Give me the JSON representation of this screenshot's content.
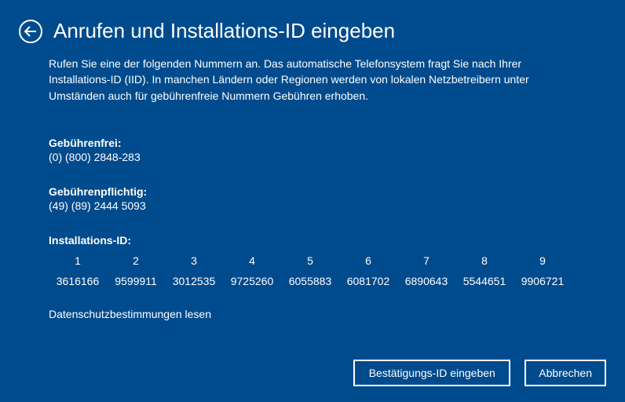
{
  "title": "Anrufen und Installations-ID eingeben",
  "intro": "Rufen Sie eine der folgenden Nummern an. Das automatische Telefonsystem fragt Sie nach Ihrer Installations-ID (IID). In manchen Ländern oder Regionen werden von lokalen Netzbetreibern unter Umständen auch für gebührenfreie Nummern Gebühren erhoben.",
  "toll_free": {
    "label": "Gebührenfrei:",
    "value": "(0) (800) 2848-283"
  },
  "toll": {
    "label": "Gebührenpflichtig:",
    "value": "(49) (89) 2444 5093"
  },
  "iid": {
    "label": "Installations-ID:",
    "cols": [
      {
        "n": "1",
        "v": "3616166"
      },
      {
        "n": "2",
        "v": "9599911"
      },
      {
        "n": "3",
        "v": "3012535"
      },
      {
        "n": "4",
        "v": "9725260"
      },
      {
        "n": "5",
        "v": "6055883"
      },
      {
        "n": "6",
        "v": "6081702"
      },
      {
        "n": "7",
        "v": "6890643"
      },
      {
        "n": "8",
        "v": "5544651"
      },
      {
        "n": "9",
        "v": "9906721"
      }
    ]
  },
  "privacy": "Datenschutzbestimmungen lesen",
  "buttons": {
    "confirm": "Bestätigungs-ID eingeben",
    "cancel": "Abbrechen"
  }
}
